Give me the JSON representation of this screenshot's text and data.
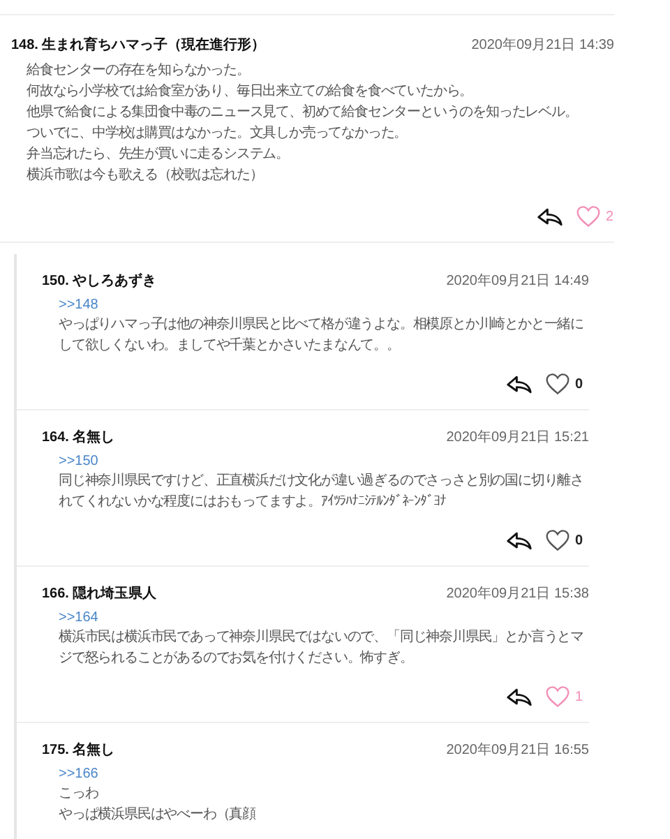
{
  "comment": {
    "number": "148.",
    "name": "生まれ育ちハマっ子（現在進行形）",
    "date": "2020年09月21日 14:39",
    "lines": [
      "給食センターの存在を知らなかった。",
      "何故なら小学校では給食室があり、毎日出来立ての給食を食べていたから。",
      "他県で給食による集団食中毒のニュース見て、初めて給食センターというのを知ったレベル。",
      "ついでに、中学校は購買はなかった。文具しか売ってなかった。",
      "弁当忘れたら、先生が買いに走るシステム。",
      "横浜市歌は今も歌える（校歌は忘れた）"
    ],
    "liked": true,
    "likes": "2"
  },
  "replies": [
    {
      "number": "150.",
      "name": "やしろあずき",
      "date": "2020年09月21日 14:49",
      "anchor": ">>148",
      "lines": [
        "やっぱりハマっ子は他の神奈川県民と比べて格が違うよな。相模原とか川崎とかと一緒にして欲しくないわ。ましてや千葉とかさいたまなんて。。"
      ],
      "liked": false,
      "likes": "0"
    },
    {
      "number": "164.",
      "name": "名無し",
      "date": "2020年09月21日 15:21",
      "anchor": ">>150",
      "lines": [
        "同じ神奈川県民ですけど、正直横浜だけ文化が違い過ぎるのでさっさと別の国に切り離されてくれないかな程度にはおもってますよ。ｱｲﾂﾗﾊﾅﾆｼﾃﾙﾝﾀﾞﾈｰﾝﾀﾞﾖﾅ"
      ],
      "liked": false,
      "likes": "0"
    },
    {
      "number": "166.",
      "name": "隠れ埼玉県人",
      "date": "2020年09月21日 15:38",
      "anchor": ">>164",
      "lines": [
        "横浜市民は横浜市民であって神奈川県民ではないので、「同じ神奈川県民」とか言うとマジで怒られることがあるのでお気を付けください。怖すぎ。"
      ],
      "liked": true,
      "likes": "1"
    },
    {
      "number": "175.",
      "name": "名無し",
      "date": "2020年09月21日 16:55",
      "anchor": ">>166",
      "lines": [
        "こっわ",
        "やっぱ横浜県民はやべーわ（真顔"
      ]
    }
  ]
}
